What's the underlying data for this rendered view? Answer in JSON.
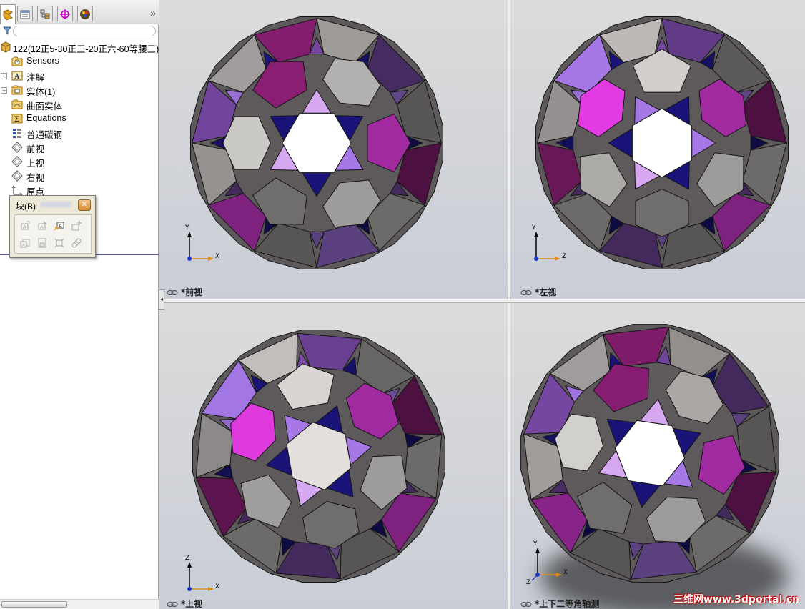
{
  "tabs": {
    "items": [
      {
        "name": "feature-manager"
      },
      {
        "name": "property-manager"
      },
      {
        "name": "configuration-manager"
      },
      {
        "name": "dimxpert-manager"
      },
      {
        "name": "display-manager"
      }
    ],
    "more": "»"
  },
  "tree": {
    "root": "122(12正5-30正三-20正六-60等腰三)",
    "items": [
      {
        "label": "Sensors",
        "icon": "sensors-folder-icon",
        "expander": false
      },
      {
        "label": "注解",
        "icon": "annotations-icon",
        "expander": true
      },
      {
        "label": "实体(1)",
        "icon": "solid-bodies-icon",
        "expander": true
      },
      {
        "label": "曲面实体",
        "icon": "surface-bodies-icon",
        "expander": false
      },
      {
        "label": "Equations",
        "icon": "equations-icon",
        "expander": false
      },
      {
        "label": "普通碳钢",
        "icon": "material-icon",
        "expander": false
      },
      {
        "label": "前视",
        "icon": "plane-icon",
        "expander": false
      },
      {
        "label": "上视",
        "icon": "plane-icon",
        "expander": false
      },
      {
        "label": "右视",
        "icon": "plane-icon",
        "expander": false
      },
      {
        "label": "原点",
        "icon": "origin-icon",
        "expander": false
      }
    ]
  },
  "block_toolbar": {
    "title": "块(B)"
  },
  "viewports": {
    "front": {
      "label": "*前视",
      "axis_h": "X",
      "axis_v": "Y"
    },
    "left": {
      "label": "*左视",
      "axis_h": "Z",
      "axis_v": "Y"
    },
    "top": {
      "label": "*上视",
      "axis_h": "X",
      "axis_v": "Z"
    },
    "iso": {
      "label": "*上下二等角轴测",
      "axis_h": "X",
      "axis_v": "Y",
      "axis_z": "Z"
    }
  },
  "watermark": "三维网www.3dportal.cn",
  "colors": {
    "white": "#ffffff",
    "light": "#e2dfdc",
    "mid": "#c6c2bf",
    "grey": "#a09c9b",
    "dark": "#5e5a5c",
    "navy": "#1a1478",
    "magenta": "#e63ce6",
    "purple": "#a578e6",
    "violet": "#7a4aa8",
    "plum": "#8a1e74",
    "lilac": "#d6a8f2"
  }
}
